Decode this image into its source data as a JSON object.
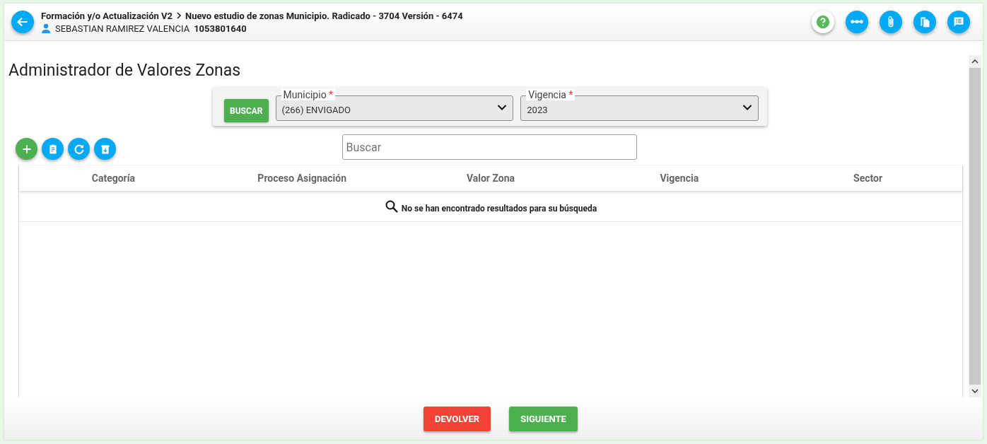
{
  "header": {
    "breadcrumb": [
      "Formación y/o Actualización V2",
      "Nuevo estudio de zonas Municipio. Radicado - 3704 Versión - 6474"
    ],
    "user_name": "SEBASTIAN RAMIREZ VALENCIA",
    "user_id": "1053801640"
  },
  "page_title": "Administrador de Valores Zonas",
  "filter": {
    "button": "BUSCAR",
    "fields": [
      {
        "label": "Municipio",
        "required_mark": "*",
        "value": "(266) ENVIGADO"
      },
      {
        "label": "Vigencia",
        "required_mark": "*",
        "value": "2023"
      }
    ]
  },
  "search": {
    "placeholder": "Buscar"
  },
  "table": {
    "columns": [
      "Categoría",
      "Proceso Asignación",
      "Valor Zona",
      "Vigencia",
      "Sector"
    ],
    "empty_message": "No se han encontrado resultados para su búsqueda"
  },
  "footer_buttons": [
    {
      "label": "DEVOLVER",
      "kind": "danger"
    },
    {
      "label": "SIGUIENTE",
      "kind": "success"
    }
  ]
}
